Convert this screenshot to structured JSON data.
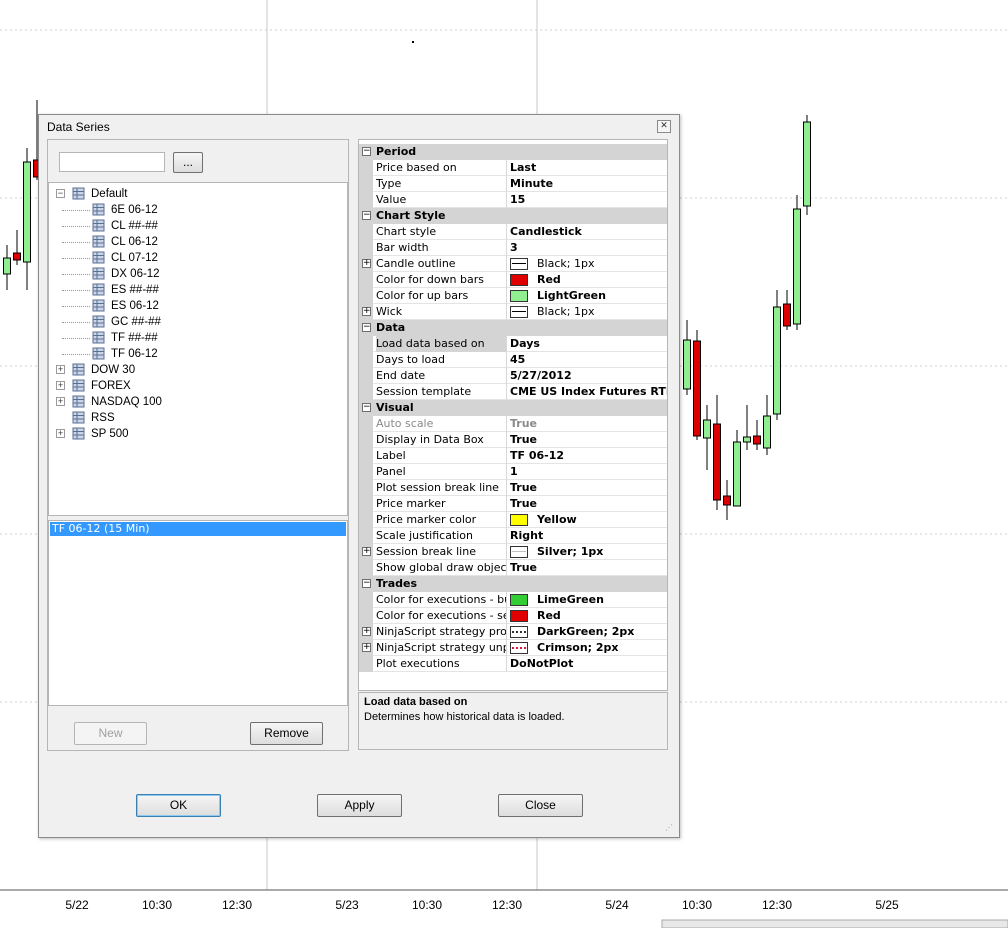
{
  "chart": {
    "x_ticks": [
      {
        "label": "5/22"
      },
      {
        "label": "10:30"
      },
      {
        "label": "12:30"
      },
      {
        "label": "5/23"
      },
      {
        "label": "10:30"
      },
      {
        "label": "12:30"
      },
      {
        "label": "5/24"
      },
      {
        "label": "10:30"
      },
      {
        "label": "12:30"
      },
      {
        "label": "5/25"
      }
    ],
    "up_color": "#90ee90",
    "down_color": "#dd0000"
  },
  "dialog": {
    "title": "Data Series",
    "close_icon": "close-icon",
    "search": {
      "value": "",
      "placeholder": ""
    },
    "browse_label": "...",
    "tree": {
      "root": {
        "label": "Default",
        "expanded": true,
        "children": [
          "6E 06-12",
          "CL ##-##",
          "CL 06-12",
          "CL 07-12",
          "DX 06-12",
          "ES ##-##",
          "ES 06-12",
          "GC ##-##",
          "TF ##-##",
          "TF 06-12"
        ]
      },
      "groups": [
        {
          "label": "DOW 30",
          "expandable": true
        },
        {
          "label": "FOREX",
          "expandable": true
        },
        {
          "label": "NASDAQ 100",
          "expandable": true
        },
        {
          "label": "RSS",
          "expandable": false
        },
        {
          "label": "SP 500",
          "expandable": true
        }
      ]
    },
    "selected_series": "TF 06-12 (15 Min)",
    "buttons": {
      "new": "New",
      "remove": "Remove",
      "ok": "OK",
      "apply": "Apply",
      "close": "Close"
    },
    "properties": [
      {
        "kind": "cat",
        "label": "Period"
      },
      {
        "kind": "prop",
        "label": "Price based on",
        "value": "Last"
      },
      {
        "kind": "prop",
        "label": "Type",
        "value": "Minute"
      },
      {
        "kind": "prop",
        "label": "Value",
        "value": "15"
      },
      {
        "kind": "cat",
        "label": "Chart Style"
      },
      {
        "kind": "prop",
        "label": "Chart style",
        "value": "Candlestick"
      },
      {
        "kind": "prop",
        "label": "Bar width",
        "value": "3"
      },
      {
        "kind": "prop",
        "label": "Candle outline",
        "value": "Black; 1px",
        "expand": true,
        "swatch": "line-solid",
        "plain": true
      },
      {
        "kind": "prop",
        "label": "Color for down bars",
        "value": "Red",
        "swatch": "#e00000"
      },
      {
        "kind": "prop",
        "label": "Color for up bars",
        "value": "LightGreen",
        "swatch": "#90ee90"
      },
      {
        "kind": "prop",
        "label": "Wick",
        "value": "Black; 1px",
        "expand": true,
        "swatch": "line-solid",
        "plain": true
      },
      {
        "kind": "cat",
        "label": "Data"
      },
      {
        "kind": "prop",
        "label": "Load data based on",
        "value": "Days",
        "selected": true
      },
      {
        "kind": "prop",
        "label": "Days to load",
        "value": "45"
      },
      {
        "kind": "prop",
        "label": "End date",
        "value": "5/27/2012"
      },
      {
        "kind": "prop",
        "label": "Session template",
        "value": "CME US Index Futures RTH"
      },
      {
        "kind": "cat",
        "label": "Visual"
      },
      {
        "kind": "prop",
        "label": "Auto scale",
        "value": "True",
        "disabled": true
      },
      {
        "kind": "prop",
        "label": "Display in Data Box",
        "value": "True"
      },
      {
        "kind": "prop",
        "label": "Label",
        "value": "TF 06-12"
      },
      {
        "kind": "prop",
        "label": "Panel",
        "value": "1"
      },
      {
        "kind": "prop",
        "label": "Plot session break line",
        "value": "True"
      },
      {
        "kind": "prop",
        "label": "Price marker",
        "value": "True"
      },
      {
        "kind": "prop",
        "label": "Price marker color",
        "value": "Yellow",
        "swatch": "#ffff00"
      },
      {
        "kind": "prop",
        "label": "Scale justification",
        "value": "Right"
      },
      {
        "kind": "prop",
        "label": "Session break line",
        "value": "Silver; 1px",
        "expand": true,
        "swatch": "line-silver"
      },
      {
        "kind": "prop",
        "label": "Show global draw objects",
        "value": "True"
      },
      {
        "kind": "cat",
        "label": "Trades"
      },
      {
        "kind": "prop",
        "label": "Color for executions - buy",
        "value": "LimeGreen",
        "swatch": "#32cd32"
      },
      {
        "kind": "prop",
        "label": "Color for executions - sell",
        "value": "Red",
        "swatch": "#e00000"
      },
      {
        "kind": "prop",
        "label": "NinjaScript strategy profitable",
        "value": "DarkGreen; 2px",
        "expand": true,
        "swatch": "line-dot"
      },
      {
        "kind": "prop",
        "label": "NinjaScript strategy unprofitable",
        "value": "Crimson; 2px",
        "expand": true,
        "swatch": "line-dot-red"
      },
      {
        "kind": "prop",
        "label": "Plot executions",
        "value": "DoNotPlot"
      }
    ],
    "description": {
      "title": "Load data based on",
      "text": "Determines how historical data is loaded."
    }
  }
}
